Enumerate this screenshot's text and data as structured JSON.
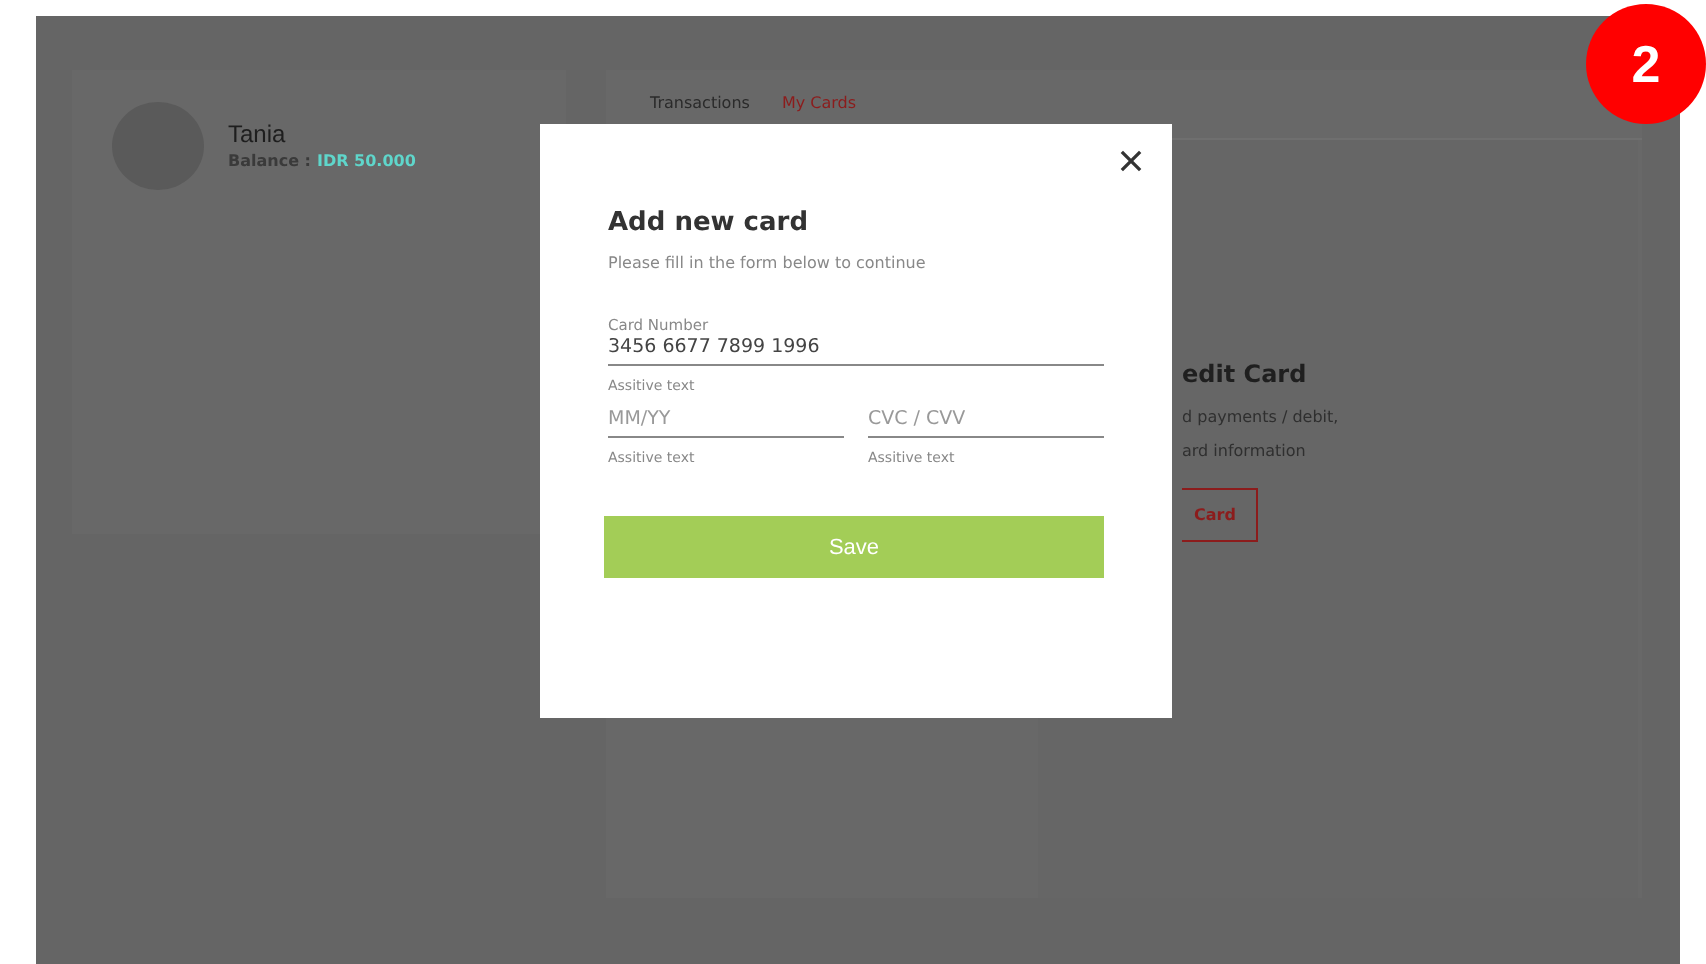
{
  "profile": {
    "name": "Tania",
    "balance_label": "Balance :",
    "balance": "IDR 50.000"
  },
  "tabs": [
    {
      "label": "Transactions",
      "selected": false
    },
    {
      "label": "My Cards",
      "selected": true
    }
  ],
  "empty_state": {
    "title": "edit Card",
    "lines": [
      "d payments / debit,",
      "ard information"
    ],
    "button": "Card"
  },
  "dialog": {
    "title": "Add new card",
    "subtitle": "Please fill in the form below to continue",
    "fields": [
      {
        "label": "Card Number",
        "value": "3456 6677 7899 1996",
        "helper": "Assitive text",
        "wide": true
      },
      {
        "placeholder": "MM/YY",
        "helper": "Assitive text",
        "wide": false
      },
      {
        "placeholder": "CVC / CVV",
        "helper": "Assitive text",
        "wide": false
      }
    ],
    "button": "Save"
  },
  "step_badge": "2"
}
